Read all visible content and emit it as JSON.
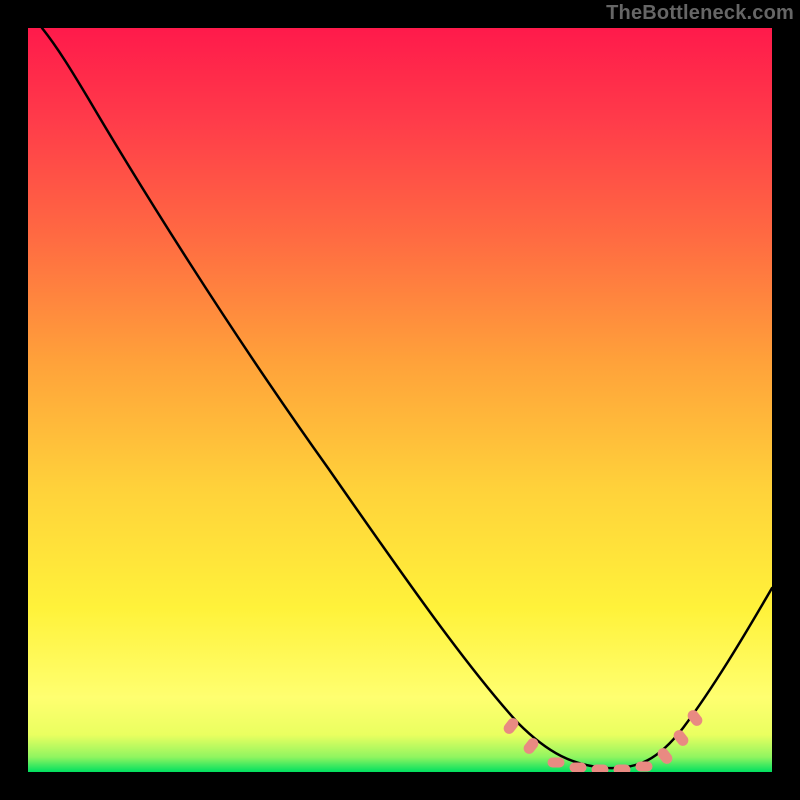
{
  "watermark": "TheBottleneck.com",
  "chart_data": {
    "type": "line",
    "title": "",
    "xlabel": "",
    "ylabel": "",
    "xlim": [
      0,
      100
    ],
    "ylim": [
      0,
      100
    ],
    "grid": false,
    "legend": false,
    "gradient_colors": {
      "top": "#ff1a4b",
      "mid1": "#ff7a3a",
      "mid2": "#ffe23a",
      "low": "#ffff6a",
      "bottom": "#00e060"
    },
    "series": [
      {
        "name": "curve",
        "stroke": "#000000",
        "x": [
          2,
          5,
          8,
          12,
          18,
          25,
          32,
          40,
          48,
          56,
          62,
          66,
          70,
          74,
          78,
          82,
          85,
          88,
          92,
          96,
          100
        ],
        "y": [
          100,
          98,
          95,
          91,
          84,
          75,
          66,
          56,
          46,
          36,
          28,
          22,
          15,
          9,
          5,
          3,
          3,
          6,
          12,
          20,
          29
        ]
      },
      {
        "name": "valley-markers",
        "stroke": "#e98a82",
        "marker_shape": "rounded-dash",
        "x": [
          65,
          68,
          71,
          73,
          75,
          77,
          79,
          82,
          85,
          86,
          87,
          88
        ],
        "y": [
          20,
          14,
          9,
          6,
          4,
          3,
          3,
          3,
          4,
          7,
          10,
          14
        ]
      }
    ],
    "annotations": []
  }
}
